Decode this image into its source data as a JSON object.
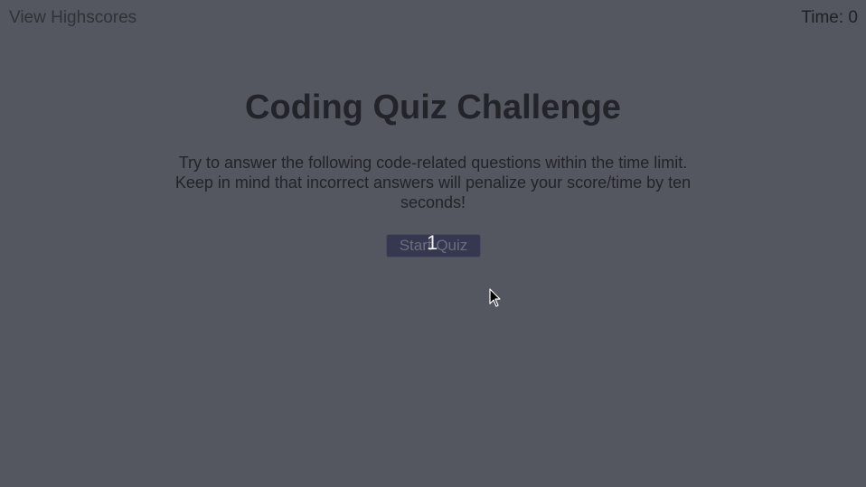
{
  "header": {
    "view_highscores": "View Highscores",
    "timer": "Time: 0"
  },
  "main": {
    "title": "Coding Quiz Challenge",
    "description": "Try to answer the following code-related questions within the time limit. Keep in mind that incorrect answers will penalize your score/time by ten seconds!",
    "start_button": "Start Quiz",
    "countdown_overlay": "1"
  },
  "colors": {
    "background": "#54575f",
    "text": "#23242a",
    "button_bg": "#363850"
  },
  "icons": {
    "cursor": "mouse-pointer-icon"
  }
}
